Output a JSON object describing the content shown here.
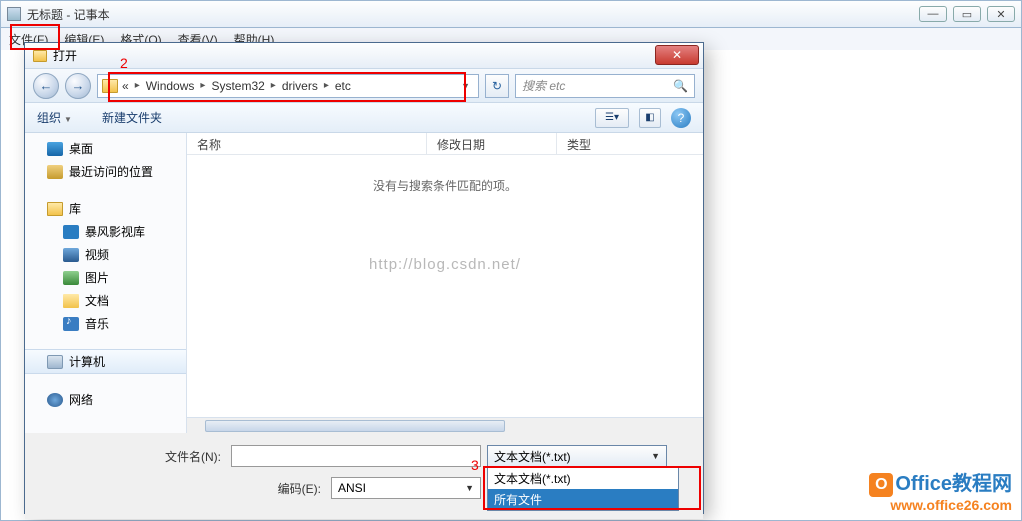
{
  "notepad": {
    "title": "无标题 - 记事本",
    "menu": {
      "file": "文件(F)",
      "edit": "编辑(E)",
      "format": "格式(O)",
      "view": "查看(V)",
      "help": "帮助(H)"
    }
  },
  "dialog": {
    "title": "打开",
    "close_glyph": "✕",
    "back_glyph": "←",
    "fwd_glyph": "→",
    "breadcrumb_prefix": "«",
    "breadcrumb": [
      "Windows",
      "System32",
      "drivers",
      "etc"
    ],
    "search_placeholder": "搜索 etc",
    "refresh_glyph": "↻",
    "toolbar": {
      "organize": "组织",
      "new_folder": "新建文件夹"
    },
    "tree": {
      "desktop": "桌面",
      "recent": "最近访问的位置",
      "libraries": "库",
      "baofeng": "暴风影视库",
      "videos": "视频",
      "pictures": "图片",
      "documents": "文档",
      "music": "音乐",
      "computer": "计算机",
      "network": "网络"
    },
    "columns": {
      "name": "名称",
      "date": "修改日期",
      "type": "类型"
    },
    "empty_msg": "没有与搜索条件匹配的项。",
    "watermark": "http://blog.csdn.net/",
    "filename_label": "文件名(N):",
    "encoding_label": "编码(E):",
    "encoding_value": "ANSI",
    "file_type_selected": "文本文档(*.txt)",
    "file_type_options": [
      "文本文档(*.txt)",
      "所有文件"
    ]
  },
  "annotations": {
    "label2": "2",
    "label3": "3"
  },
  "logo": {
    "top": "Office教程网",
    "bottom": "www.office26.com"
  }
}
